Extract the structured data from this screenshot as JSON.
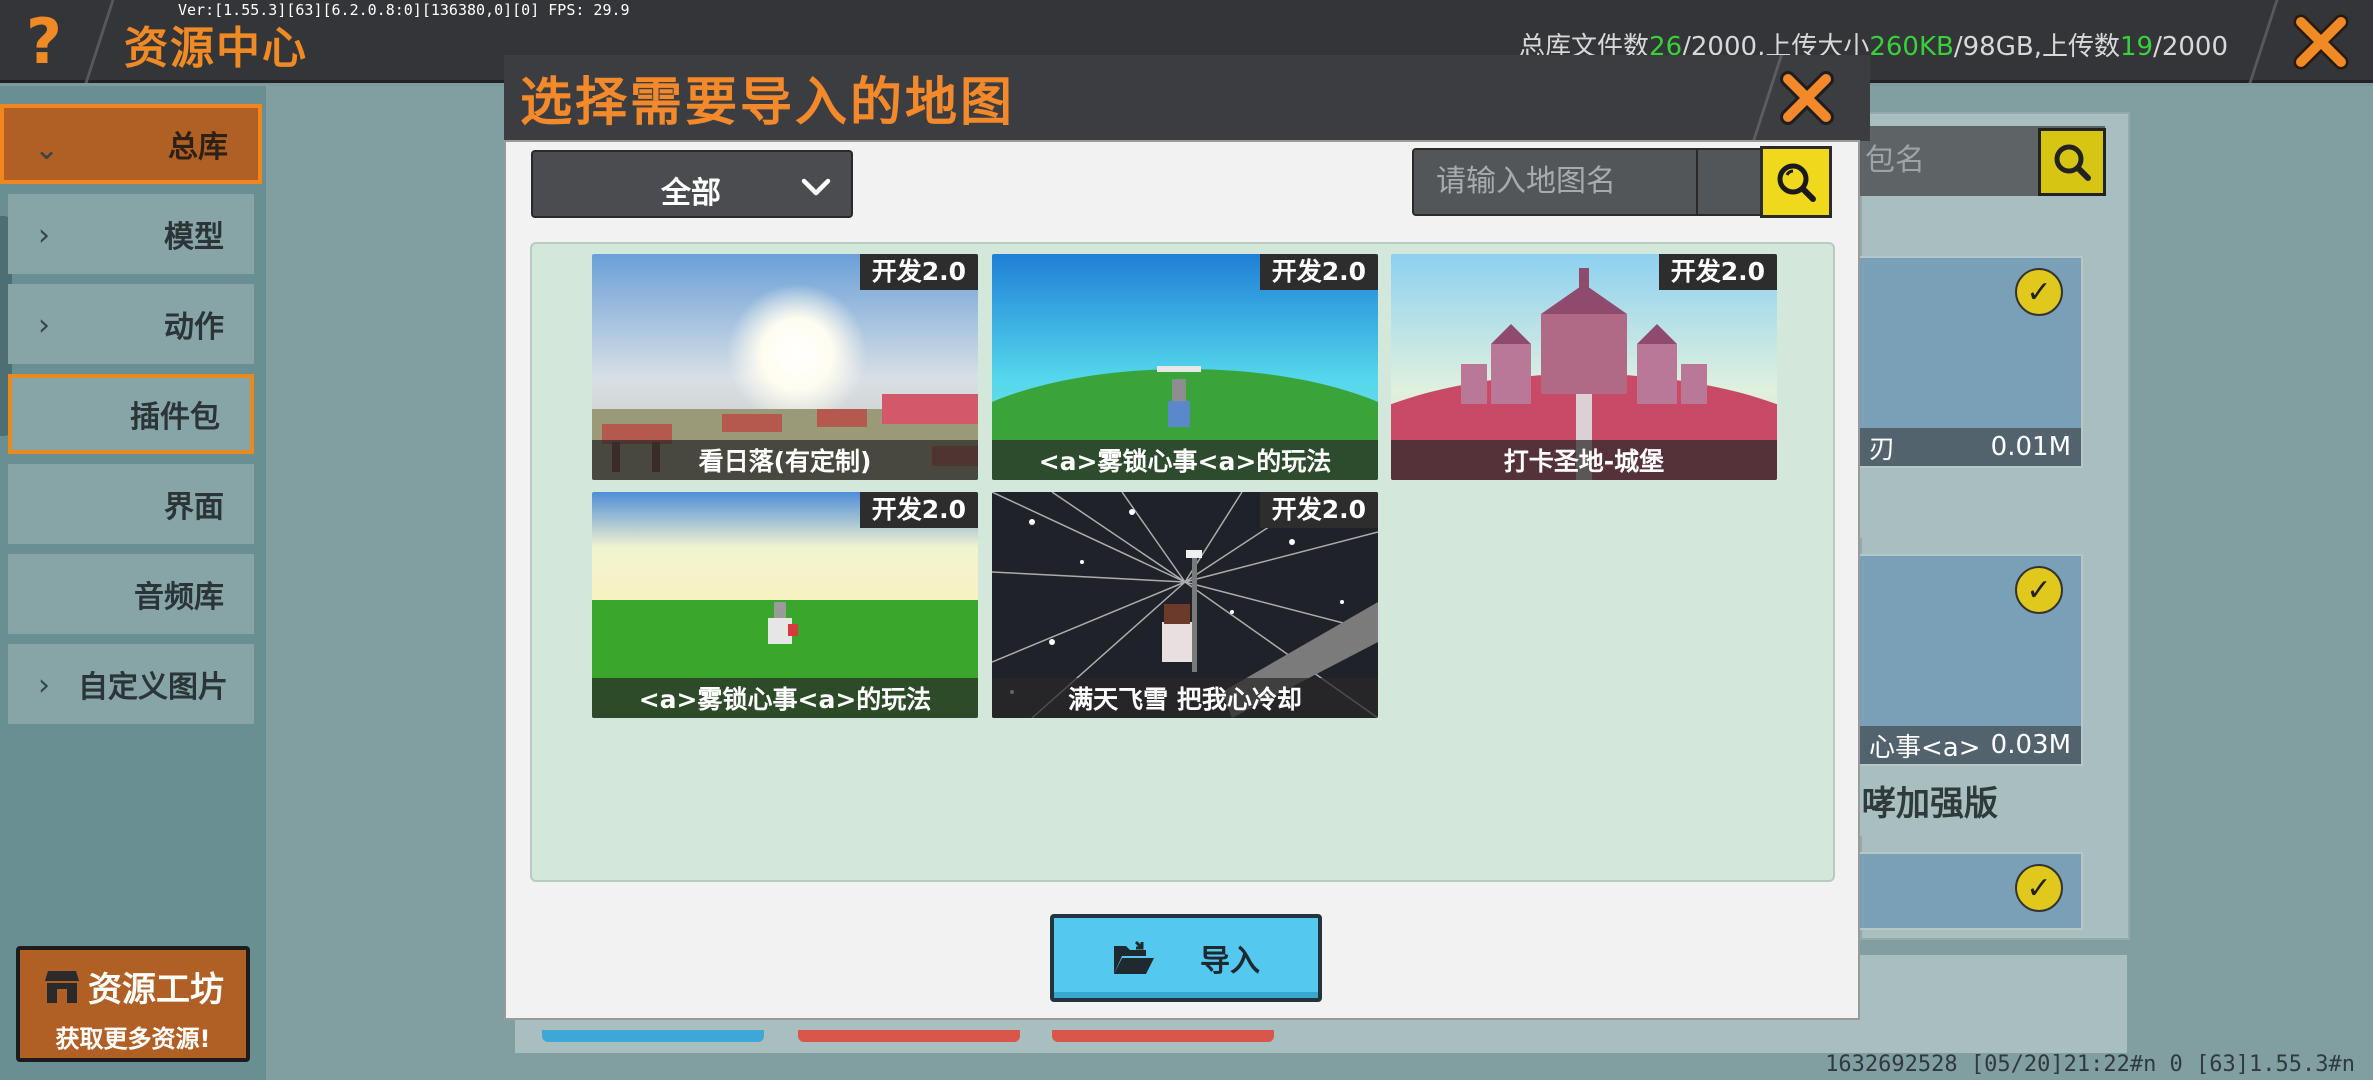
{
  "topbar": {
    "help_label": "?",
    "title": "资源中心",
    "debug": "Ver:[1.55.3][63][6.2.0.8:0][136380,0][0] FPS: 29.9",
    "stats": {
      "file_label": "总库文件数",
      "file_used": "26",
      "file_total": "/2000,",
      "size_label": "上传大小",
      "size_used": "260KB",
      "size_total": "/98GB,",
      "upload_label": "上传数",
      "upload_used": "19",
      "upload_total": "/2000"
    }
  },
  "sidebar": {
    "items": [
      {
        "label": "总库",
        "chev": "⌄"
      },
      {
        "label": "模型",
        "chev": "›"
      },
      {
        "label": "动作",
        "chev": "›"
      },
      {
        "label": "插件包",
        "chev": ""
      },
      {
        "label": "界面",
        "chev": ""
      },
      {
        "label": "音频库",
        "chev": ""
      },
      {
        "label": "自定义图片",
        "chev": "›"
      }
    ],
    "workshop_title": "资源工坊",
    "workshop_sub": "获取更多资源!"
  },
  "background": {
    "search_partial": "包名",
    "cards": [
      {
        "name": "刃",
        "size": "0.01M"
      },
      {
        "name": "心事<a>",
        "size": "0.03M"
      }
    ],
    "card_title": "哮加强版",
    "bottom_info": "1632692528   [05/20]21:22#n 0   [63]1.55.3#n"
  },
  "modal": {
    "title": "选择需要导入的地图",
    "filter": {
      "value": "全部"
    },
    "search": {
      "placeholder": "请输入地图名"
    },
    "maps": [
      {
        "name": "看日落(有定制)",
        "badge": "开发2.0"
      },
      {
        "name": "<a>雾锁心事<a>的玩法",
        "badge": "开发2.0"
      },
      {
        "name": "打卡圣地-城堡",
        "badge": "开发2.0"
      },
      {
        "name": "<a>雾锁心事<a>的玩法",
        "badge": "开发2.0"
      },
      {
        "name": "满天飞雪 把我心冷却",
        "badge": "开发2.0"
      }
    ],
    "import_label": "导入"
  },
  "colors": {
    "accent": "#f08a24",
    "stat_green": "#38d13a",
    "import_blue": "#55c8ef",
    "search_yellow": "#f0d81c"
  }
}
